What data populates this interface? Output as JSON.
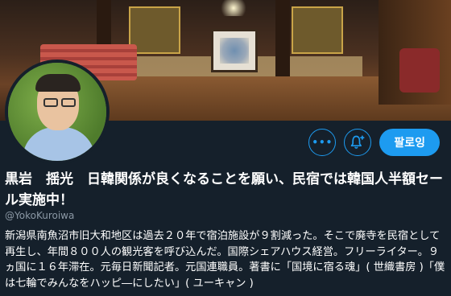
{
  "profile": {
    "name": "黒岩　揺光　日韓関係が良くなることを願い、民宿では韓国人半額セール実施中！",
    "handle": "@YokoKuroiwa",
    "bio": "新潟県南魚沼市旧大和地区は過去２０年で宿泊施設が９割減った。そこで廃寺を民宿として再生し、年間８００人の観光客を呼び込んだ。国際シェアハウス経営。フリーライター。９ヵ国に１６年滞在。元毎日新聞記者。元国連職員。著書に「国境に宿る魂」( 世織書房 )「僕は七輪でみんなをハッピ―にしたい」( ユーキャン )"
  },
  "actions": {
    "more_label": "•••",
    "follow_label": "팔로잉"
  },
  "icons": {
    "more": "more-icon",
    "bell": "bell-plus-icon"
  },
  "colors": {
    "background": "#15202b",
    "accent": "#1d9bf0",
    "secondary_text": "#8b98a5"
  }
}
